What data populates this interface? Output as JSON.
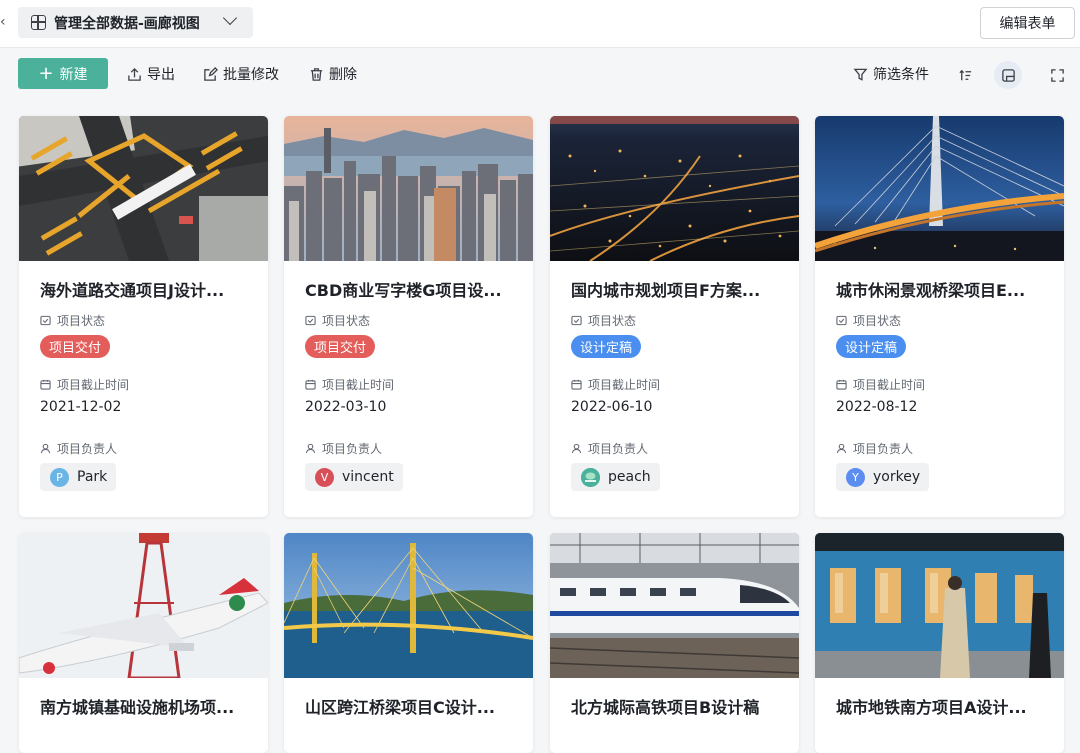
{
  "header": {
    "view_title": "管理全部数据-画廊视图",
    "edit_form_label": "编辑表单"
  },
  "toolbar": {
    "new_label": "新建",
    "export_label": "导出",
    "batch_edit_label": "批量修改",
    "delete_label": "删除",
    "filter_label": "筛选条件"
  },
  "labels": {
    "status": "项目状态",
    "deadline": "项目截止时间",
    "owner": "项目负责人"
  },
  "colors": {
    "accent": "#4bb19b",
    "delivered": "#e35d5b",
    "finalized": "#4a8ff0"
  },
  "cards": [
    {
      "title": "海外道路交通项目J设计...",
      "status": "项目交付",
      "status_color": "#e35d5b",
      "deadline": "2021-12-02",
      "owner": "Park",
      "avatar_letter": "P",
      "avatar_color": "#6bb5e6",
      "image": "aerial-road-intersection"
    },
    {
      "title": "CBD商业写字楼G项目设...",
      "status": "项目交付",
      "status_color": "#e35d5b",
      "deadline": "2022-03-10",
      "owner": "vincent",
      "avatar_letter": "V",
      "avatar_color": "#d94f57",
      "image": "city-skyline-harbor"
    },
    {
      "title": "国内城市规划项目F方案...",
      "status": "设计定稿",
      "status_color": "#4a8ff0",
      "deadline": "2022-06-10",
      "owner": "peach",
      "avatar_letter": "",
      "avatar_color": "#4bb19b",
      "image": "city-night-aerial"
    },
    {
      "title": "城市休闲景观桥梁项目E...",
      "status": "设计定稿",
      "status_color": "#4a8ff0",
      "deadline": "2022-08-12",
      "owner": "yorkey",
      "avatar_letter": "Y",
      "avatar_color": "#5b8ef0",
      "image": "cable-bridge-dusk"
    },
    {
      "title": "南方城镇基础设施机场项...",
      "image": "airplane-takeoff"
    },
    {
      "title": "山区跨江桥梁项目C设计...",
      "image": "suspension-bridge-river"
    },
    {
      "title": "北方城际高铁项目B设计稿",
      "image": "bullet-train-station"
    },
    {
      "title": "城市地铁南方项目A设计...",
      "image": "metro-platform"
    }
  ]
}
